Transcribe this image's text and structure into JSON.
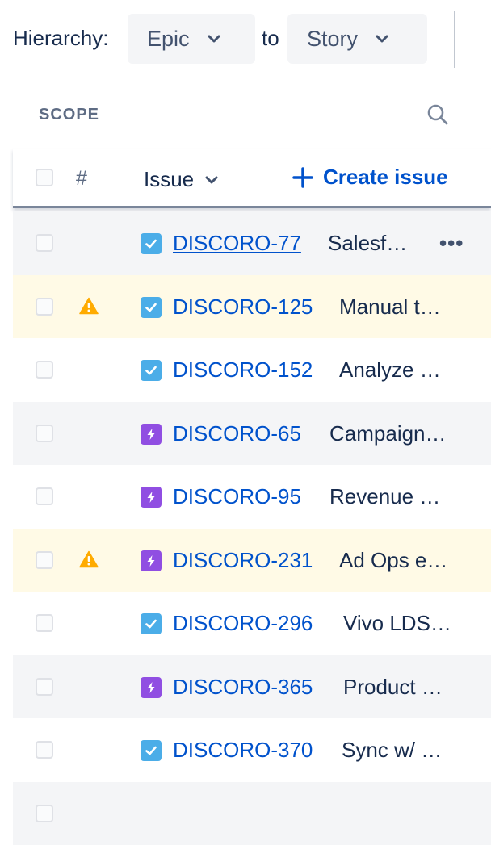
{
  "toolbar": {
    "hierarchy_label": "Hierarchy:",
    "from_level": "Epic",
    "to_label": "to",
    "to_level": "Story"
  },
  "scope": {
    "title": "SCOPE"
  },
  "table_header": {
    "rank": "#",
    "issue": "Issue",
    "create_issue": "Create issue"
  },
  "colors": {
    "link": "#0052cc",
    "story_type": "#4bade8",
    "feature_type": "#904ee2",
    "warning": "#ffab00",
    "warning_row": "#fffae6",
    "alt_row": "#f4f5f7"
  },
  "rows": [
    {
      "key": "DISCORO-77",
      "summary": "Salesf…",
      "type": "checkbox-story-icon",
      "warning": false
    },
    {
      "key": "DISCORO-125",
      "summary": "Manual t…",
      "type": "checkbox-story-icon",
      "warning": true
    },
    {
      "key": "DISCORO-152",
      "summary": "Analyze …",
      "type": "checkbox-story-icon",
      "warning": false
    },
    {
      "key": "DISCORO-65",
      "summary": "Campaign…",
      "type": "lightning-feature-icon",
      "warning": false
    },
    {
      "key": "DISCORO-95",
      "summary": "Revenue …",
      "type": "lightning-feature-icon",
      "warning": false
    },
    {
      "key": "DISCORO-231",
      "summary": "Ad Ops e…",
      "type": "lightning-feature-icon",
      "warning": true
    },
    {
      "key": "DISCORO-296",
      "summary": "Vivo LDS…",
      "type": "checkbox-story-icon",
      "warning": false
    },
    {
      "key": "DISCORO-365",
      "summary": "Product …",
      "type": "lightning-feature-icon",
      "warning": false
    },
    {
      "key": "DISCORO-370",
      "summary": "Sync w/ …",
      "type": "checkbox-story-icon",
      "warning": false
    }
  ]
}
